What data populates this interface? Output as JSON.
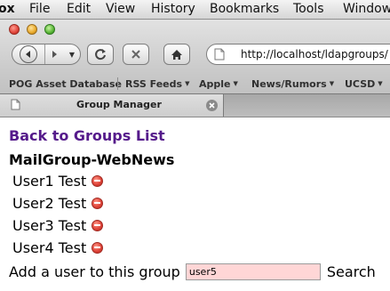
{
  "menubar": {
    "app_name": "ox",
    "items": [
      "File",
      "Edit",
      "View",
      "History",
      "Bookmarks",
      "Tools",
      "Window"
    ]
  },
  "toolbar": {
    "url": "http://localhost/ldapgroups/"
  },
  "bookmarks": [
    {
      "label": "POG Asset Database",
      "has_menu": false
    },
    {
      "label": "RSS Feeds",
      "has_menu": true
    },
    {
      "label": "Apple",
      "has_menu": true
    },
    {
      "label": "News/Rumors",
      "has_menu": true
    },
    {
      "label": "UCSD",
      "has_menu": true
    }
  ],
  "tab": {
    "title": "Group Manager"
  },
  "page": {
    "back_link": "Back to Groups List",
    "group_name": "MailGroup-WebNews",
    "users": [
      "User1 Test",
      "User2 Test",
      "User3 Test",
      "User4 Test"
    ],
    "add_label": "Add a user to this group",
    "add_input_value": "user5",
    "search_label": "Search"
  },
  "colors": {
    "link_visited": "#551a8b",
    "input_background": "#ffd6d6",
    "remove_icon": "#e0453a"
  },
  "icons": {
    "back": "left-arrow-icon",
    "forward": "right-arrow-icon",
    "reload": "reload-icon",
    "stop": "stop-icon",
    "home": "home-icon",
    "page": "page-icon",
    "close_tab": "close-icon",
    "remove_user": "remove-icon"
  }
}
